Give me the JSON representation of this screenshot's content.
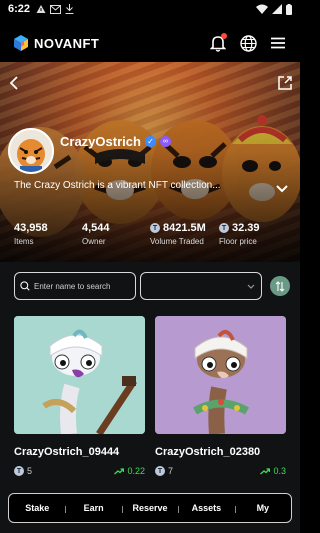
{
  "status_bar": {
    "time": "6:22",
    "left_icons": [
      "alert-icon",
      "mail-icon",
      "download-icon"
    ],
    "right_icons": [
      "wifi-icon",
      "signal-icon",
      "battery-icon"
    ]
  },
  "header": {
    "brand": "NOVANFT",
    "icons": [
      "notification-bell-icon",
      "globe-icon",
      "menu-icon"
    ],
    "notification_dot_color": "#ff4b3a"
  },
  "collection": {
    "name": "CrazyOstrich",
    "description": "The Crazy Ostrich is a vibrant NFT collection...",
    "stats": [
      {
        "value": "43,958",
        "label": "Items",
        "coin": false
      },
      {
        "value": "4,544",
        "label": "Owner",
        "coin": false
      },
      {
        "value": "8421.5M",
        "label": "Volume Traded",
        "coin": true
      },
      {
        "value": "32.39",
        "label": "Floor price",
        "coin": true
      }
    ]
  },
  "filters": {
    "search_placeholder": "Enter name to search",
    "select_value": ""
  },
  "items": [
    {
      "name": "CrazyOstrich_09444",
      "price": "5",
      "change": "0.22",
      "bg_color": "#a8d8cf"
    },
    {
      "name": "CrazyOstrich_02380",
      "price": "7",
      "change": "0.3",
      "bg_color": "#b69ad0"
    }
  ],
  "bottom_nav": [
    "Stake",
    "Earn",
    "Reserve",
    "Assets",
    "My"
  ],
  "colors": {
    "accent_green": "#3fdc58",
    "verified_blue": "#3d8bff",
    "chain_purple": "#8a5cff",
    "sort_button": "#6a9a86"
  }
}
